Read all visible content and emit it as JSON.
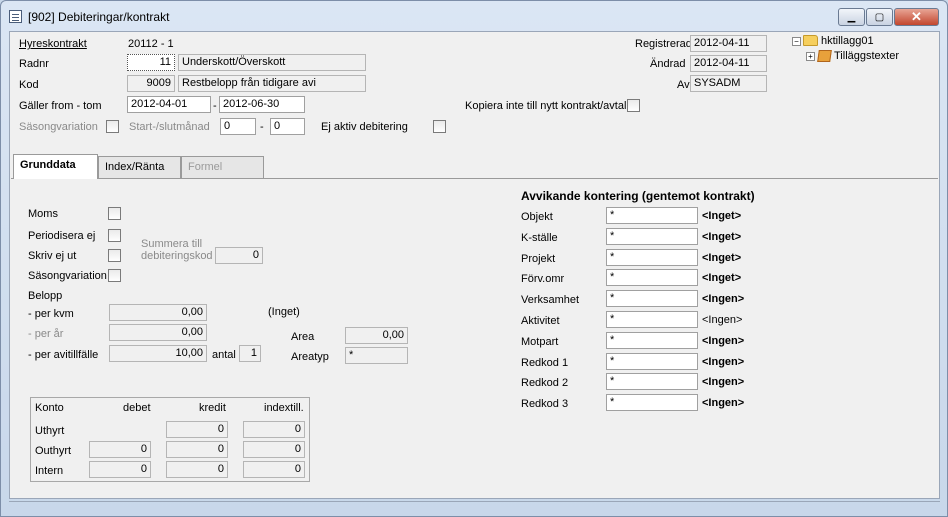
{
  "window": {
    "title": "[902]  Debiteringar/kontrakt",
    "buttons": {
      "minimize": "▁",
      "maximize": "▢",
      "close": "✕"
    }
  },
  "header": {
    "hyreskontrakt_label": "Hyreskontrakt",
    "hyreskontrakt_value": "20112 - 1",
    "radnr_label": "Radnr",
    "radnr_value": "11",
    "radnr_text": "Underskott/Överskott",
    "kod_label": "Kod",
    "kod_value": "9009",
    "kod_text": "Restbelopp från tidigare avi",
    "galler_label": "Gäller from - tom",
    "galler_from": "2012-04-01",
    "galler_sep": "-",
    "galler_tom": "2012-06-30",
    "sasong_label": "Säsongvariation",
    "start_slut_label": "Start-/slutmånad",
    "start_value": "0",
    "start_sep": "-",
    "slut_value": "0",
    "ej_aktiv_label": "Ej aktiv debitering",
    "registrerad_label": "Registrerad",
    "registrerad_value": "2012-04-11",
    "andrad_label": "Ändrad",
    "andrad_value": "2012-04-11",
    "av_label": "Av",
    "av_value": "SYSADM",
    "kopiera_label": "Kopiera inte till nytt kontrakt/avtal"
  },
  "tree": {
    "root": "hktillagg01",
    "child": "Tilläggstexter"
  },
  "tabs": [
    {
      "label": "Grunddata"
    },
    {
      "label": "Index/Ränta"
    },
    {
      "label": "Formel"
    }
  ],
  "grunddata": {
    "moms_label": "Moms",
    "periodisera_label": "Periodisera ej",
    "skriv_label": "Skriv ej ut",
    "sasong_label": "Säsongvariation",
    "summera_label_1": "Summera till",
    "summera_label_2": "debiteringskod",
    "summera_value": "0",
    "belopp_label": "Belopp",
    "per_kvm_label": "- per kvm",
    "per_kvm_value": "0,00",
    "inget_label": "(Inget)",
    "per_ar_label": "- per år",
    "per_ar_value": "0,00",
    "area_label": "Area",
    "area_value": "0,00",
    "per_avi_label": "- per avitillfälle",
    "per_avi_value": "10,00",
    "antal_label": "antal",
    "antal_value": "1",
    "areatyp_label": "Areatyp",
    "areatyp_value": "*"
  },
  "konto": {
    "headers": [
      "Konto",
      "debet",
      "kredit",
      "indextill."
    ],
    "rows": [
      {
        "label": "Uthyrt",
        "debet": "",
        "kredit": "0",
        "index": "0"
      },
      {
        "label": "Outhyrt",
        "debet": "0",
        "kredit": "0",
        "index": "0"
      },
      {
        "label": "Intern",
        "debet": "0",
        "kredit": "0",
        "index": "0"
      }
    ]
  },
  "kontering": {
    "title": "Avvikande kontering (gentemot kontrakt)",
    "rows": [
      {
        "label": "Objekt",
        "value": "*",
        "desc": "<Inget>"
      },
      {
        "label": "K-ställe",
        "value": "*",
        "desc": "<Inget>"
      },
      {
        "label": "Projekt",
        "value": "*",
        "desc": "<Inget>"
      },
      {
        "label": "Förv.omr",
        "value": "*",
        "desc": "<Inget>"
      },
      {
        "label": "Verksamhet",
        "value": "*",
        "desc": "<Ingen>"
      },
      {
        "label": "Aktivitet",
        "value": "*",
        "desc": "<Ingen>"
      },
      {
        "label": "Motpart",
        "value": "*",
        "desc": "<Ingen>"
      },
      {
        "label": "Redkod 1",
        "value": "*",
        "desc": "<Ingen>"
      },
      {
        "label": "Redkod 2",
        "value": "*",
        "desc": "<Ingen>"
      },
      {
        "label": "Redkod 3",
        "value": "*",
        "desc": "<Ingen>"
      }
    ]
  }
}
